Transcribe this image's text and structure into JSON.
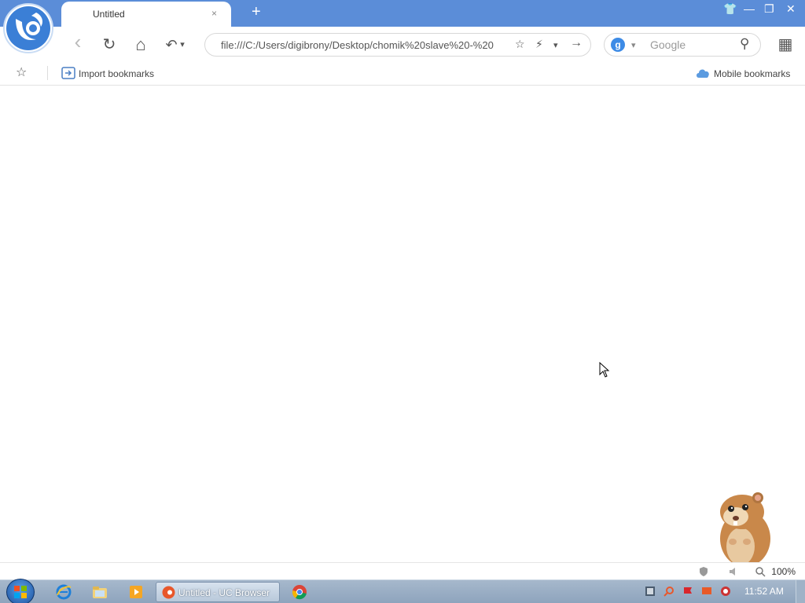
{
  "window": {
    "app_title": "UC Browser",
    "tab_title": "Untitled",
    "tab_close": "×",
    "new_tab": "+",
    "controls": {
      "skin": "👕",
      "minimize": "—",
      "restore": "❐",
      "close": "✕"
    }
  },
  "toolbar": {
    "back": "‹",
    "reload": "↻",
    "home": "⌂",
    "undo": "↶",
    "undo_dropdown": "▾",
    "address_value": "file:///C:/Users/digibrony/Desktop/chomik%20slave%20-%20",
    "address_icons": {
      "star": "☆",
      "speed": "⚡",
      "dropdown": "▾",
      "go": "→"
    },
    "search_engine_badge": "g",
    "search_engine_dropdown": "▾",
    "search_placeholder": "Google",
    "search_icon": "⚲",
    "apps": "▦"
  },
  "bookmarks": {
    "star": "☆",
    "import_label": "Import bookmarks",
    "mobile_label": "Mobile bookmarks"
  },
  "status": {
    "zoom": "100%"
  },
  "taskbar": {
    "active_task_label": "Untitled - UC Browser",
    "clock": "11:52 AM"
  },
  "colors": {
    "titlebar": "#5b8dd8",
    "accent": "#3d8be6"
  }
}
